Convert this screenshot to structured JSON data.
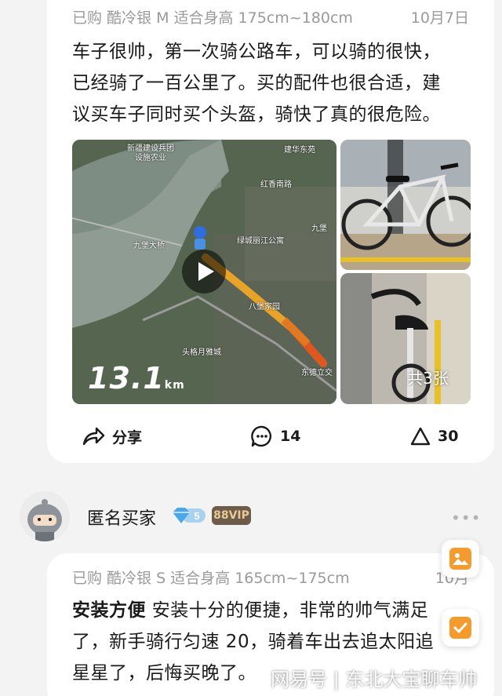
{
  "review1": {
    "meta": "已购  酷冷银 M  适合身高 175cm~180cm",
    "date": "10月7日",
    "lines": [
      "车子很帅，第一次骑公路车，可以骑的很快，",
      "已经骑了一百公里了。买的配件也很合适，建",
      "议买车子同时买个头盔，骑快了真的很危险。"
    ],
    "video": {
      "distance": "13.1",
      "unit": "km",
      "labels": [
        "新疆建设兵团",
        "设施农业",
        "建华东苑",
        "红香南路",
        "九堡大桥",
        "绿城丽江公寓",
        "九堡",
        "八堡家园",
        "头格月雅城",
        "东德立交"
      ]
    },
    "photo_count": "共3张",
    "actions": {
      "share": "分享",
      "comments": "14",
      "likes": "30"
    }
  },
  "reviewer2": {
    "name": "匿名买家",
    "level": "5",
    "vip": "88VIP"
  },
  "review2": {
    "meta": "已购  酷冷银 S  适合身高 165cm~175cm",
    "date": "10月",
    "highlight": "安装方便",
    "line1_rest": " 安装十分的便捷，非常的帅气满足",
    "line2": "了，新手骑行匀速 20，骑着车出去追太阳追",
    "line3": "星星了，后悔买晚了。"
  },
  "watermark": "网易号 | 东北大宝聊车帅",
  "colors": {
    "accent": "#f59b2e",
    "vip_bg": "#6e5c4a",
    "vip_text": "#e9c995"
  }
}
